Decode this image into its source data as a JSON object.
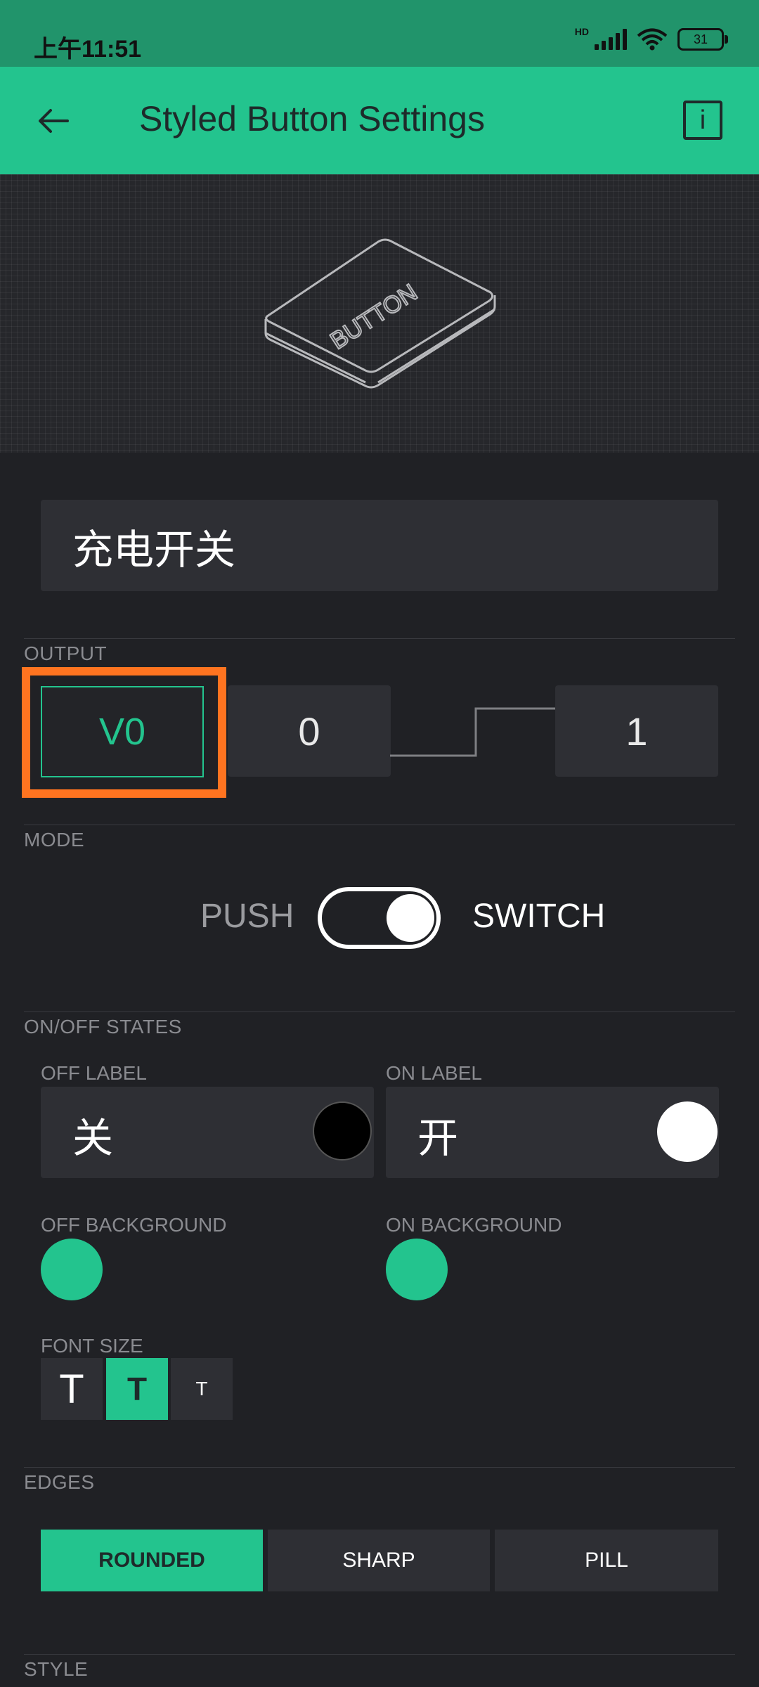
{
  "status_bar": {
    "time": "上午11:51",
    "network_label": "HD",
    "battery": "31"
  },
  "toolbar": {
    "title": "Styled Button Settings",
    "info_label": "i"
  },
  "illustration": {
    "button_text": "BUTTON"
  },
  "name_field": {
    "value": "充电开关"
  },
  "output": {
    "section_label": "OUTPUT",
    "pin": "V0",
    "low_value": "0",
    "high_value": "1"
  },
  "mode": {
    "section_label": "MODE",
    "push_label": "PUSH",
    "switch_label": "SWITCH",
    "selected": "SWITCH"
  },
  "states": {
    "section_label": "ON/OFF STATES",
    "off_label_title": "OFF LABEL",
    "off_label_value": "关",
    "off_label_color": "#000000",
    "on_label_title": "ON LABEL",
    "on_label_value": "开",
    "on_label_color": "#ffffff",
    "off_background_title": "OFF BACKGROUND",
    "off_background_color": "#23c48e",
    "on_background_title": "ON BACKGROUND",
    "on_background_color": "#23c48e"
  },
  "font_size": {
    "title": "FONT SIZE",
    "options": [
      "T",
      "T",
      "T"
    ],
    "selected_index": 1
  },
  "edges": {
    "section_label": "EDGES",
    "options": [
      "ROUNDED",
      "SHARP",
      "PILL"
    ],
    "selected": "ROUNDED"
  },
  "style": {
    "section_label": "STYLE"
  },
  "colors": {
    "accent": "#23c48e",
    "background": "#202125",
    "highlight": "#ff7420"
  }
}
